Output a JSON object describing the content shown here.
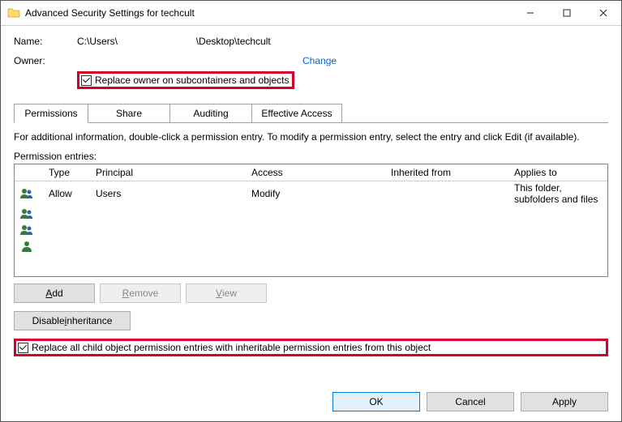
{
  "window": {
    "title": "Advanced Security Settings for techcult"
  },
  "header": {
    "name_label": "Name:",
    "name_value": "C:\\Users\\                             \\Desktop\\techcult",
    "owner_label": "Owner:",
    "change_link": "Change",
    "replace_owner_label": "Replace owner on subcontainers and objects"
  },
  "tabs": {
    "permissions": "Permissions",
    "share": "Share",
    "auditing": "Auditing",
    "effective": "Effective Access"
  },
  "info_line": "For additional information, double-click a permission entry. To modify a permission entry, select the entry and click Edit (if available).",
  "entries_label": "Permission entries:",
  "columns": {
    "type": "Type",
    "principal": "Principal",
    "access": "Access",
    "inherited": "Inherited from",
    "applies": "Applies to"
  },
  "rows": [
    {
      "type": "Allow",
      "principal": "Users",
      "access": "Modify",
      "inherited": "",
      "applies": "This folder, subfolders and files"
    },
    {
      "type": "",
      "principal": "",
      "access": "",
      "inherited": "",
      "applies": ""
    },
    {
      "type": "",
      "principal": "",
      "access": "",
      "inherited": "",
      "applies": ""
    },
    {
      "type": "",
      "principal": "",
      "access": "",
      "inherited": "",
      "applies": ""
    }
  ],
  "buttons": {
    "add": "Add",
    "remove": "Remove",
    "view": "View",
    "disable_inh": "Disable inheritance"
  },
  "replace_all": "Replace all child object permission entries with inheritable permission entries from this object",
  "footer": {
    "ok": "OK",
    "cancel": "Cancel",
    "apply": "Apply"
  },
  "icons": {
    "group": "group",
    "person": "person"
  }
}
